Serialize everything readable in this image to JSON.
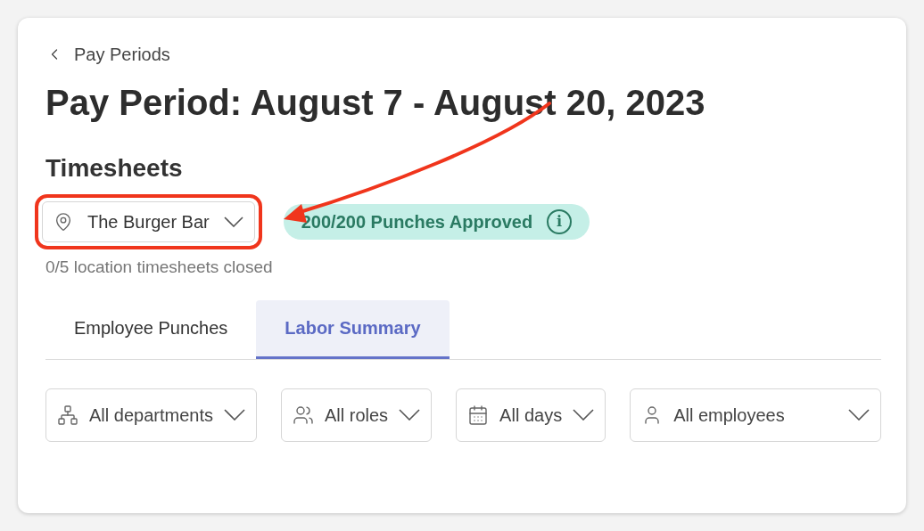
{
  "breadcrumb": {
    "label": "Pay Periods"
  },
  "title": "Pay Period: August 7 - August 20, 2023",
  "section_title": "Timesheets",
  "location": {
    "value": "The Burger Bar",
    "highlighted": true
  },
  "status_badge": {
    "label": "200/200 Punches Approved",
    "info_icon": "i"
  },
  "closed_note": "0/5 location timesheets closed",
  "tabs": [
    {
      "label": "Employee Punches",
      "selected": false
    },
    {
      "label": "Labor Summary",
      "selected": true
    }
  ],
  "filters": [
    {
      "kind": "departments",
      "value": "All departments"
    },
    {
      "kind": "roles",
      "value": "All roles"
    },
    {
      "kind": "days",
      "value": "All days"
    },
    {
      "kind": "employees",
      "value": "All employees"
    }
  ],
  "annotation": {
    "arrow": true
  }
}
